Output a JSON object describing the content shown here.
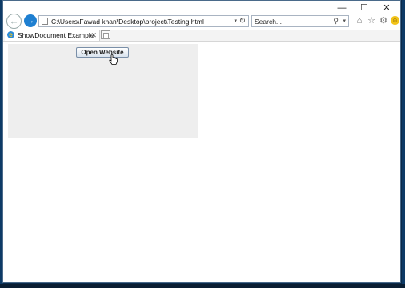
{
  "window": {
    "minimize_glyph": "—",
    "maximize_glyph": "☐",
    "close_glyph": "✕"
  },
  "nav": {
    "back_glyph": "←",
    "forward_glyph": "→",
    "address": "C:\\Users\\Fawad khan\\Desktop\\project\\Testing.html",
    "address_dropdown_glyph": "▾",
    "refresh_glyph": "↻",
    "search_placeholder": "Search...",
    "search_glyph": "⚲",
    "search_dropdown_glyph": "▾"
  },
  "toolbar": {
    "home_glyph": "⌂",
    "favorites_glyph": "☆",
    "settings_glyph": "⚙",
    "feedback_glyph": "☺"
  },
  "tabs": [
    {
      "label": "ShowDocument Example",
      "close_glyph": "✕",
      "icon_glyph": "e"
    }
  ],
  "applet": {
    "button_label": "Open Website",
    "background": "#eeeeee"
  },
  "colors": {
    "accent": "#1e7fd1",
    "desktop": "#0a2a4a"
  }
}
